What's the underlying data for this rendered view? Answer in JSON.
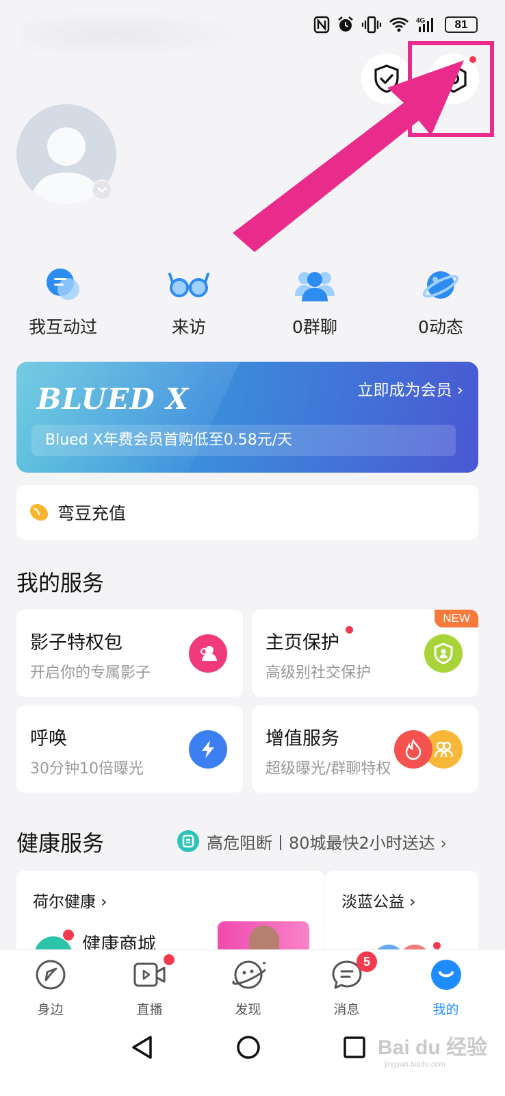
{
  "status_bar": {
    "battery": "81",
    "network": "4G"
  },
  "stats": [
    {
      "label": "我互动过",
      "icon": "chat-bubble-icon"
    },
    {
      "label": "来访",
      "icon": "glasses-icon"
    },
    {
      "label": "0群聊",
      "icon": "group-icon"
    },
    {
      "label": "0动态",
      "icon": "planet-icon"
    }
  ],
  "banner": {
    "title": "BLUED X",
    "cta": "立即成为会员 ›",
    "promo": "Blued X年费会员首购低至0.58元/天"
  },
  "recharge": {
    "label": "弯豆充值"
  },
  "services": {
    "title": "我的服务",
    "cards": [
      {
        "title": "影子特权包",
        "subtitle": "开启你的专属影子"
      },
      {
        "title": "主页保护",
        "subtitle": "高级别社交保护",
        "badge": "NEW"
      },
      {
        "title": "呼唤",
        "subtitle": "30分钟10倍曝光"
      },
      {
        "title": "增值服务",
        "subtitle": "超级曝光/群聊特权"
      }
    ]
  },
  "health": {
    "title": "健康服务",
    "link": "高危阻断丨80城最快2小时送达 ›",
    "card_left_title": "荷尔健康 ›",
    "card_left_item": "健康商城",
    "card_right_title": "淡蓝公益 ›"
  },
  "tabs": [
    {
      "label": "身边",
      "icon": "compass-icon",
      "active": false
    },
    {
      "label": "直播",
      "icon": "video-icon",
      "active": false
    },
    {
      "label": "发现",
      "icon": "planet-face-icon",
      "active": false
    },
    {
      "label": "消息",
      "icon": "message-icon",
      "active": false,
      "badge": "5"
    },
    {
      "label": "我的",
      "icon": "profile-icon",
      "active": true
    }
  ],
  "watermark": {
    "brand": "Bai du 经验",
    "url": "jingyan.baidu.com"
  },
  "colors": {
    "accent": "#1e8cff",
    "alert": "#f43a4e",
    "highlight": "#e92c8c"
  }
}
